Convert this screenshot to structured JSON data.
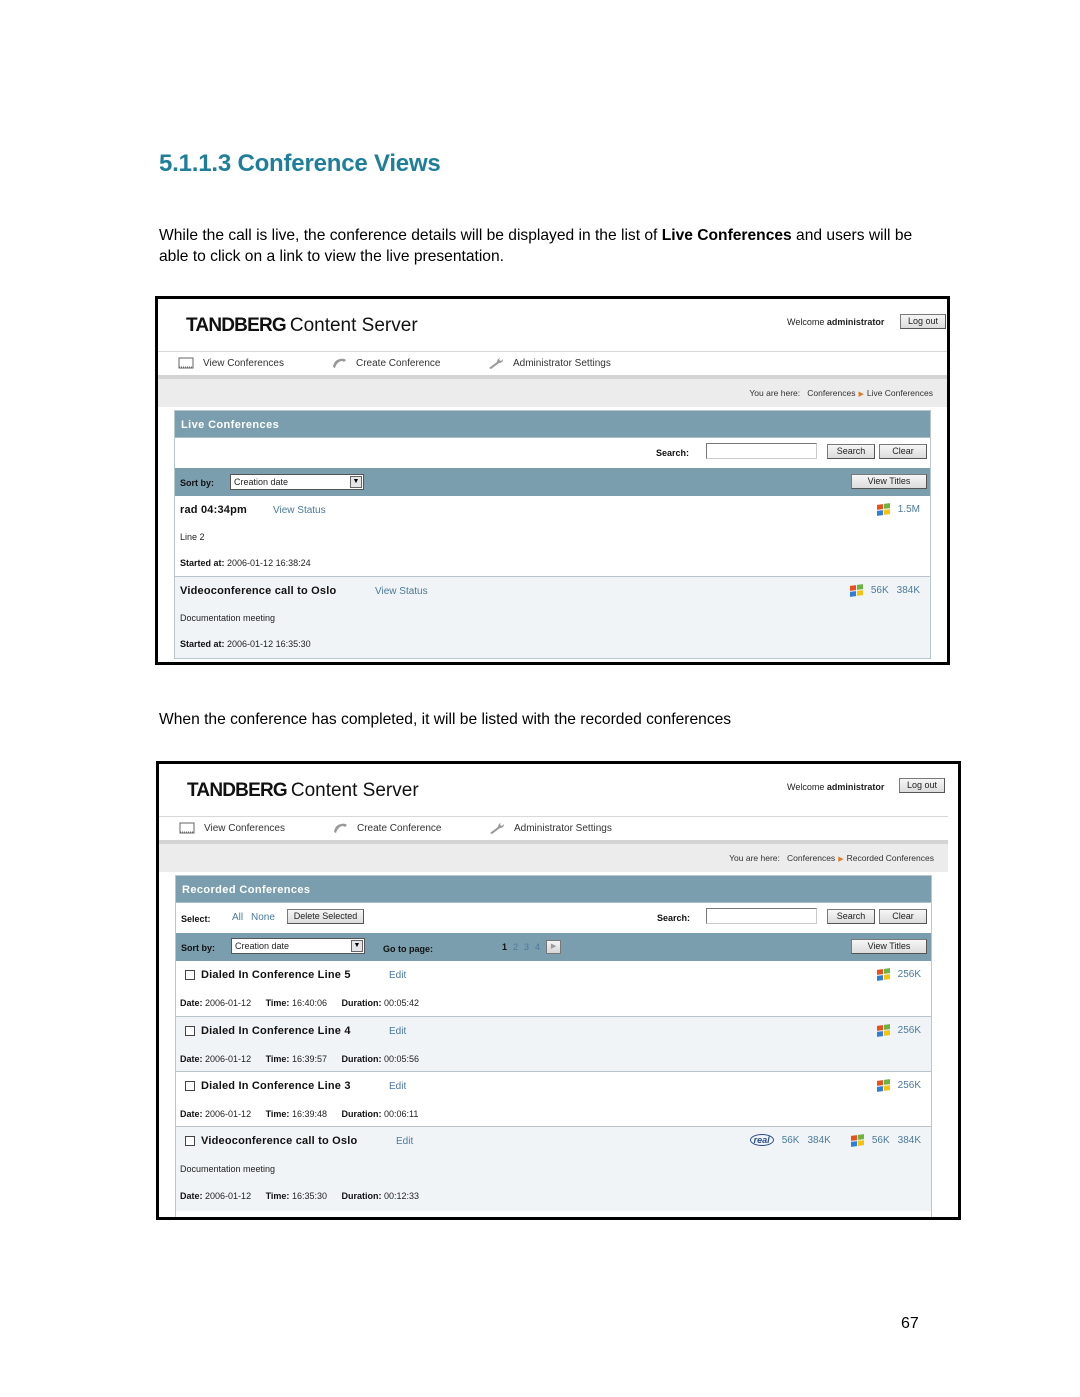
{
  "document": {
    "heading": "5.1.1.3 Conference Views",
    "paragraph1": {
      "before": "While the call is live, the conference details will be displayed in the list of ",
      "bold": "Live Conferences",
      "after": " and users will be able to click on a link to view the live presentation."
    },
    "paragraph2": "When the conference has completed, it will be listed with the recorded conferences",
    "page_number": "67"
  },
  "screens": [
    {
      "header": {
        "brand": "TANDBERG",
        "product": "Content Server",
        "welcome_prefix": "Welcome",
        "username": "administrator",
        "logout_label": "Log out"
      },
      "nav": [
        {
          "label": "View Conferences",
          "icon": "film-frame-icon"
        },
        {
          "label": "Create Conference",
          "icon": "phone-handset-icon"
        },
        {
          "label": "Administrator Settings",
          "icon": "wrench-icon"
        }
      ],
      "breadcrumb": {
        "prefix": "You are here:",
        "items": [
          "Conferences",
          "Live Conferences"
        ]
      },
      "panel": {
        "title": "Live Conferences",
        "search_label": "Search:",
        "search_value": "",
        "search_button": "Search",
        "clear_button": "Clear",
        "sort_label": "Sort by:",
        "sort_value": "Creation date",
        "view_titles_button": "View Titles"
      },
      "rows": [
        {
          "title": "rad 04:34pm",
          "link": "View Status",
          "description": "Line 2",
          "started_label": "Started at:",
          "started_value": "2006-01-12 16:38:24",
          "formats": [
            {
              "player": "windows-media",
              "rates": [
                "1.5M"
              ]
            }
          ]
        },
        {
          "title": "Videoconference call to Oslo",
          "link": "View Status",
          "description": "Documentation meeting",
          "started_label": "Started at:",
          "started_value": "2006-01-12 16:35:30",
          "formats": [
            {
              "player": "windows-media",
              "rates": [
                "56K",
                "384K"
              ]
            }
          ]
        }
      ]
    },
    {
      "header": {
        "brand": "TANDBERG",
        "product": "Content Server",
        "welcome_prefix": "Welcome",
        "username": "administrator",
        "logout_label": "Log out"
      },
      "nav": [
        {
          "label": "View Conferences",
          "icon": "film-frame-icon"
        },
        {
          "label": "Create Conference",
          "icon": "phone-handset-icon"
        },
        {
          "label": "Administrator Settings",
          "icon": "wrench-icon"
        }
      ],
      "breadcrumb": {
        "prefix": "You are here:",
        "items": [
          "Conferences",
          "Recorded Conferences"
        ]
      },
      "panel": {
        "title": "Recorded Conferences",
        "select_label": "Select:",
        "select_all": "All",
        "select_none": "None",
        "delete_selected_button": "Delete Selected",
        "search_label": "Search:",
        "search_value": "",
        "search_button": "Search",
        "clear_button": "Clear",
        "sort_label": "Sort by:",
        "sort_value": "Creation date",
        "goto_label": "Go to page:",
        "pages": [
          "1",
          "2",
          "3",
          "4"
        ],
        "current_page": "1",
        "view_titles_button": "View Titles"
      },
      "rows": [
        {
          "title": "Dialed In Conference Line 5",
          "link": "Edit",
          "checked": false,
          "date_label": "Date:",
          "date": "2006-01-12",
          "time_label": "Time:",
          "time": "16:40:06",
          "duration_label": "Duration:",
          "duration": "00:05:42",
          "formats": [
            {
              "player": "windows-media",
              "rates": [
                "256K"
              ]
            }
          ]
        },
        {
          "title": "Dialed In Conference Line 4",
          "link": "Edit",
          "checked": false,
          "date_label": "Date:",
          "date": "2006-01-12",
          "time_label": "Time:",
          "time": "16:39:57",
          "duration_label": "Duration:",
          "duration": "00:05:56",
          "formats": [
            {
              "player": "windows-media",
              "rates": [
                "256K"
              ]
            }
          ]
        },
        {
          "title": "Dialed In Conference Line 3",
          "link": "Edit",
          "checked": false,
          "date_label": "Date:",
          "date": "2006-01-12",
          "time_label": "Time:",
          "time": "16:39:48",
          "duration_label": "Duration:",
          "duration": "00:06:11",
          "formats": [
            {
              "player": "windows-media",
              "rates": [
                "256K"
              ]
            }
          ]
        },
        {
          "title": "Videoconference call to Oslo",
          "link": "Edit",
          "checked": false,
          "description": "Documentation meeting",
          "date_label": "Date:",
          "date": "2006-01-12",
          "time_label": "Time:",
          "time": "16:35:30",
          "duration_label": "Duration:",
          "duration": "00:12:33",
          "formats": [
            {
              "player": "real",
              "rates": [
                "56K",
                "384K"
              ]
            },
            {
              "player": "windows-media",
              "rates": [
                "56K",
                "384K"
              ]
            }
          ]
        }
      ]
    }
  ],
  "colors": {
    "heading": "#1f7f9b",
    "panel_header": "#7a9eae",
    "link": "#4a7a9b",
    "alt_row": "#f1f4f7",
    "breadcrumb_arrow": "#e07b2a"
  }
}
